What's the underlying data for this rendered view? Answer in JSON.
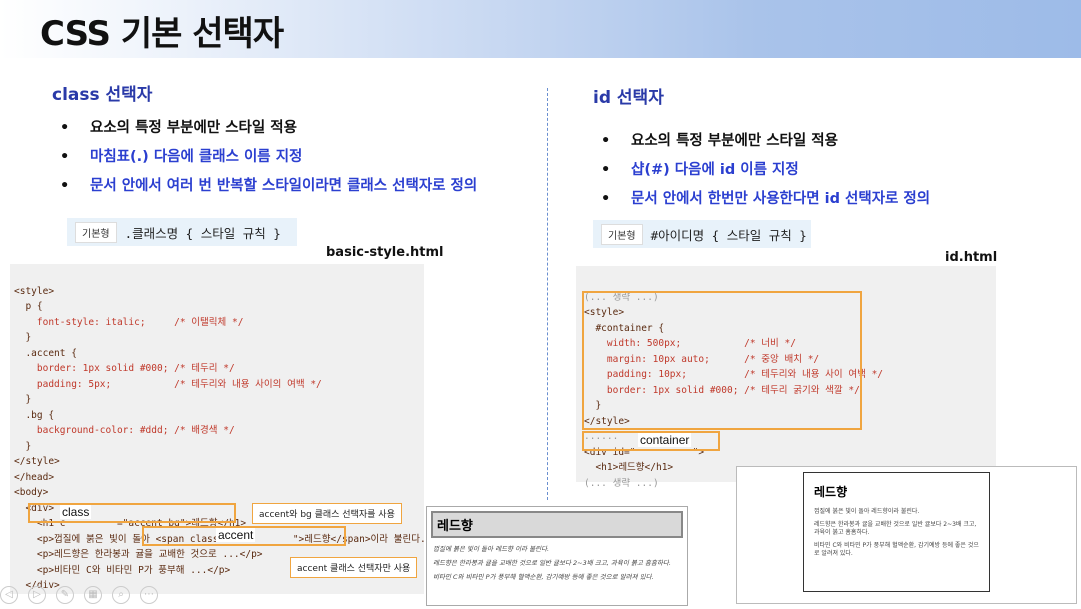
{
  "slide_title": "CSS 기본 선택자",
  "left": {
    "heading": "class 선택자",
    "bullets": [
      {
        "text": "요소의 특정 부분에만 스타일 적용",
        "style": "dark"
      },
      {
        "text": "마침표(.) 다음에 클래스 이름 지정",
        "style": "blue"
      },
      {
        "text": "문서 안에서 여러 번 반복할 스타일이라면 클래스 선택자로 정의",
        "style": "blue"
      }
    ],
    "syntax_tag": "기본형",
    "syntax": ".클래스명 { 스타일 규칙 }",
    "filename": "basic-style.html",
    "callout_1": "accent와 bg 클래스 선택자를 사용",
    "callout_2": "accent 클래스 선택자만 사용",
    "overlay_class": "class",
    "overlay_accent": "accent",
    "preview_heading": "레드향",
    "preview_lines": [
      "껍질에 붉은 빛이 돌아 레드향 이라 불린다.",
      "레드향은 한라봉과 귤을 교배한 것으로 일반 귤보다 2~3배 크고, 과육이 붉고 흠흠하다.",
      "비타민 C와 비타민 P가 풍부해 혈액순환, 감기예방 등에 좋은 것으로 알려져 있다."
    ]
  },
  "right": {
    "heading": "id 선택자",
    "bullets": [
      {
        "text": "요소의 특정 부분에만 스타일 적용",
        "style": "dark"
      },
      {
        "text": "샵(#) 다음에 id 이름 지정",
        "style": "blue"
      },
      {
        "text": "문서 안에서 한번만 사용한다면 id 선택자로 정의",
        "style": "blue"
      }
    ],
    "syntax_tag": "기본형",
    "syntax": "#아이디명 { 스타일 규칙 }",
    "filename": "id.html",
    "overlay_container": "container",
    "preview_heading": "레드향",
    "preview_lines": [
      "껍질에 붉은 빛이 돌아 레드향이라 불린다.",
      "레드향은 한라봉과 귤을 교배한 것으로 일반 귤보다 2~3배 크고, 과육이 붉고 흠흠하다.",
      "비타민 C와 비타민 P가 풍부해 혈액순환, 감기예방 등에 좋은 것으로 알려져 있다."
    ]
  },
  "code_left": [
    "<style>",
    "  p {",
    "    font-style: italic;     /* 이탤릭체 */",
    "  }",
    "  .accent {",
    "    border: 1px solid #000; /* 테두리 */",
    "    padding: 5px;           /* 테두리와 내용 사이의 여백 */",
    "  }",
    "  .bg {",
    "    background-color: #ddd; /* 배경색 */",
    "  }",
    "</style>",
    "</head>",
    "<body>",
    "  <div>",
    "    <h1 c         =\"accent bg\">레드향</h1>",
    "    <p>껍질에 붉은 빛이 돌아 <span class=\"a          \">레드향</span>이라 불린다.</p>",
    "    <p>레드향은 한라봉과 귤을 교배한 것으로 ...</p>",
    "    <p>비타민 C와 비타민 P가 풍부해 ...</p>",
    "  </div>"
  ],
  "code_right": [
    "(... 생략 ...)",
    "<style>",
    "  #container {",
    "    width: 500px;           /* 너비 */",
    "    margin: 10px auto;      /* 중앙 배치 */",
    "    padding: 10px;          /* 테두리와 내용 사이 여백 */",
    "    border: 1px solid #000; /* 테두리 굵기와 색깔 */",
    "  }",
    "</style>",
    "......",
    "<div id=\"          \">",
    "  <h1>레드향</h1>",
    "(... 생략 ...)"
  ],
  "toolbar_icons": [
    "prev-icon",
    "next-icon",
    "pen-icon",
    "screen-icon",
    "zoom-icon",
    "more-icon"
  ]
}
